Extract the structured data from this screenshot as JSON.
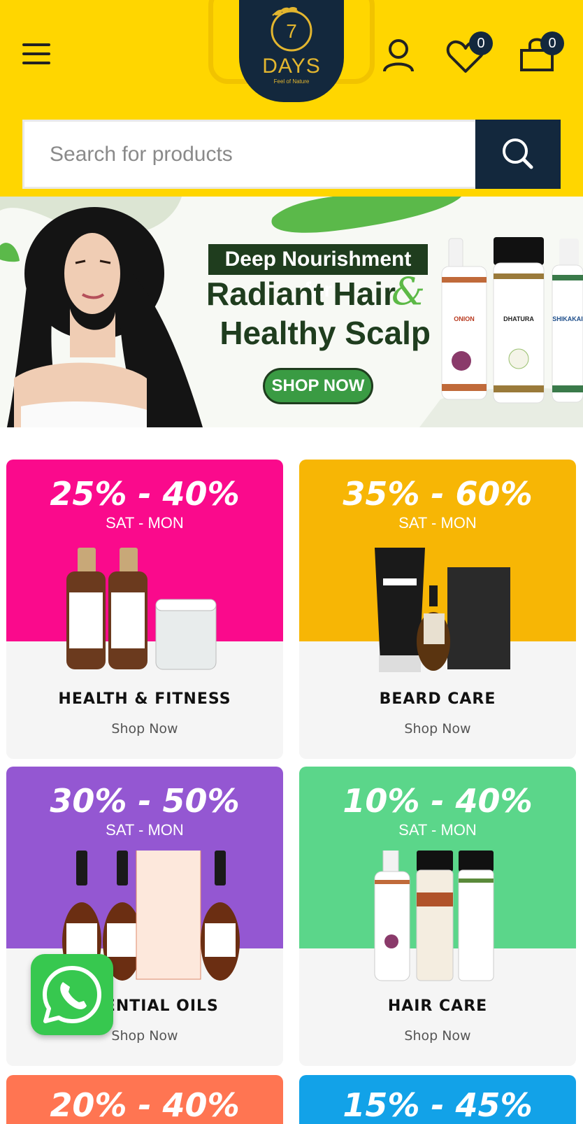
{
  "header": {
    "logo_text": "DAYS",
    "logo_number": "7",
    "logo_tagline": "Feel of Nature",
    "wishlist_count": "0",
    "cart_count": "0"
  },
  "search": {
    "placeholder": "Search for products"
  },
  "banner": {
    "headline_box": "Deep Nourishment for",
    "headline_line1": "Radiant Hair",
    "ampersand": "&",
    "headline_line2": "Healthy Scalp",
    "cta": "SHOP NOW",
    "products": [
      "ONION",
      "DHATURA",
      "SHIKAKAI"
    ]
  },
  "categories": [
    {
      "discount": "25% - 40%",
      "days": "SAT -  MON",
      "name": "HEALTH & FITNESS",
      "link": "Shop Now",
      "color": "#FA0A8C"
    },
    {
      "discount": "35% - 60%",
      "days": "SAT -  MON",
      "name": "BEARD CARE",
      "link": "Shop Now",
      "color": "#F7B605"
    },
    {
      "discount": "30% - 50%",
      "days": "SAT -  MON",
      "name": "ESSENTIAL OILS",
      "link": "Shop Now",
      "color": "#9457D2"
    },
    {
      "discount": "10% - 40%",
      "days": "SAT -  MON",
      "name": "HAIR CARE",
      "link": "Shop Now",
      "color": "#5BD68A"
    },
    {
      "discount": "20% - 40%",
      "color": "#FF7552"
    },
    {
      "discount": "15% - 45%",
      "color": "#12A2E8"
    }
  ],
  "icons": [
    "menu-icon",
    "user-icon",
    "heart-icon",
    "shopping-bag-icon",
    "search-icon",
    "whatsapp-icon"
  ]
}
